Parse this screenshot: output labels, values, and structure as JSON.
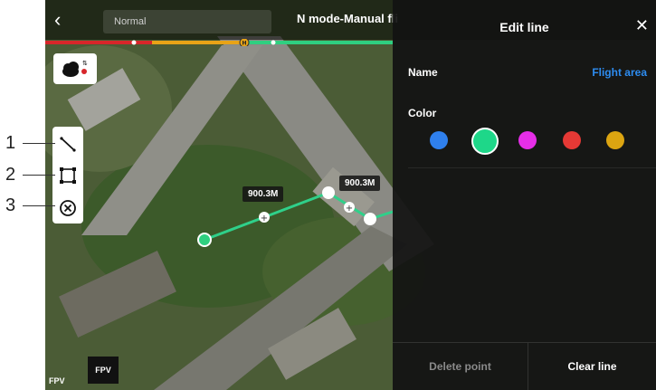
{
  "header": {
    "back_icon": "chevron-left-icon",
    "mode_label": "Normal",
    "flight_mode_title": "N mode-Manual fli"
  },
  "status_bar": {
    "segments": [
      "#d7262a",
      "#e8a317",
      "#2fcf80"
    ],
    "marker_label": "H"
  },
  "map": {
    "cloud_icon": "cloud-sync-icon",
    "tools": [
      {
        "name": "draw-line-tool",
        "icon": "line-icon"
      },
      {
        "name": "draw-area-tool",
        "icon": "rectangle-icon"
      },
      {
        "name": "clear-tool",
        "icon": "circle-x-icon"
      }
    ],
    "callouts": [
      "1",
      "2",
      "3"
    ],
    "distance_labels": [
      "900.3M",
      "900.3M"
    ],
    "fpv_label": "FPV",
    "fpv_small_label": "FPV"
  },
  "panel": {
    "title": "Edit line",
    "close_icon": "close-icon",
    "name_label": "Name",
    "name_value": "Flight area",
    "color_label": "Color",
    "colors": [
      "#2f80ed",
      "#1ed789",
      "#e62ee8",
      "#e53935",
      "#dca511"
    ],
    "selected_color_index": 1,
    "footer": {
      "delete_point": "Delete point",
      "clear_line": "Clear line"
    }
  }
}
